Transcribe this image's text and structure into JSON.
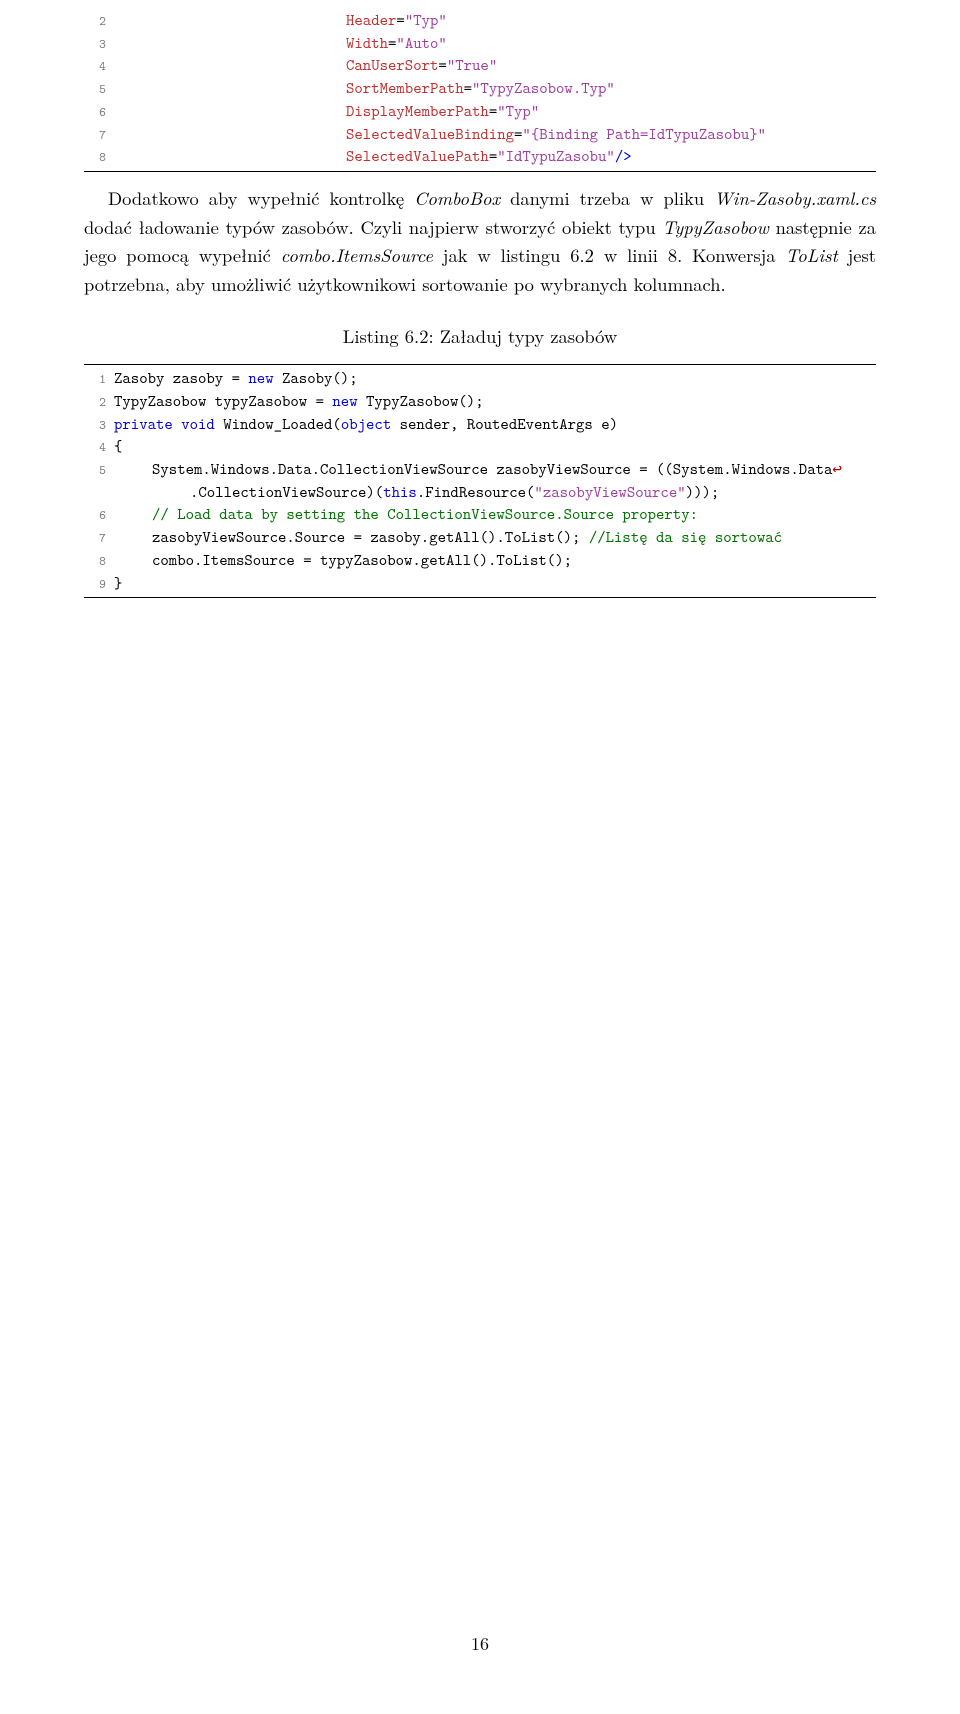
{
  "block1": {
    "lines": [
      {
        "n": "2",
        "indent": "large",
        "tokens": [
          {
            "c": "attr",
            "t": "Header"
          },
          {
            "c": "op",
            "t": "="
          },
          {
            "c": "str",
            "t": "\"Typ\""
          }
        ]
      },
      {
        "n": "3",
        "indent": "large",
        "tokens": [
          {
            "c": "attr",
            "t": "Width"
          },
          {
            "c": "op",
            "t": "="
          },
          {
            "c": "str",
            "t": "\"Auto\""
          }
        ]
      },
      {
        "n": "4",
        "indent": "large",
        "tokens": [
          {
            "c": "attr",
            "t": "CanUserSort"
          },
          {
            "c": "op",
            "t": "="
          },
          {
            "c": "str",
            "t": "\"True\""
          }
        ]
      },
      {
        "n": "5",
        "indent": "large",
        "tokens": [
          {
            "c": "attr",
            "t": "SortMemberPath"
          },
          {
            "c": "op",
            "t": "="
          },
          {
            "c": "str",
            "t": "\"TypyZasobow.Typ\""
          }
        ]
      },
      {
        "n": "6",
        "indent": "large",
        "tokens": [
          {
            "c": "attr",
            "t": "DisplayMemberPath"
          },
          {
            "c": "op",
            "t": "="
          },
          {
            "c": "str",
            "t": "\"Typ\""
          }
        ]
      },
      {
        "n": "7",
        "indent": "large",
        "tokens": [
          {
            "c": "attr",
            "t": "SelectedValueBinding"
          },
          {
            "c": "op",
            "t": "="
          },
          {
            "c": "str",
            "t": "\"{Binding Path=IdTypuZasobu}\""
          }
        ]
      },
      {
        "n": "8",
        "indent": "large",
        "tokens": [
          {
            "c": "attr",
            "t": "SelectedValuePath"
          },
          {
            "c": "op",
            "t": "="
          },
          {
            "c": "str",
            "t": "\"IdTypuZasobu\""
          },
          {
            "c": "kw",
            "t": "/>"
          }
        ]
      }
    ]
  },
  "para1": {
    "pre": "Dodatkowo aby wypełnić kontrolkę ",
    "it1": "ComboBox",
    "mid1": " danymi trzeba w pliku ",
    "it2": "Win-Zasoby.xaml.cs",
    "mid2": " dodać ładowanie typów zasobów. Czyli najpierw stworzyć obiekt typu ",
    "it3": "TypyZasobow",
    "mid3": " następnie za jego pomocą wypełnić ",
    "it4": "combo.ItemsSource",
    "mid4": " jak w listingu 6.2 w linii 8. Konwersja ",
    "it5": "ToList",
    "mid5": " jest potrzebna, aby umożliwić użytkownikowi sortowanie po wybranych kolumnach."
  },
  "caption": "Listing 6.2: Załaduj typy zasobów",
  "block2": {
    "lines": [
      {
        "n": "1",
        "indent": "",
        "tokens": [
          {
            "c": "id",
            "t": "Zasoby zasoby = "
          },
          {
            "c": "kw",
            "t": "new"
          },
          {
            "c": "id",
            "t": " Zasoby();"
          }
        ]
      },
      {
        "n": "2",
        "indent": "",
        "tokens": [
          {
            "c": "id",
            "t": "TypyZasobow typyZasobow = "
          },
          {
            "c": "kw",
            "t": "new"
          },
          {
            "c": "id",
            "t": " TypyZasobow();"
          }
        ]
      },
      {
        "n": "3",
        "indent": "",
        "tokens": [
          {
            "c": "kw",
            "t": "private void"
          },
          {
            "c": "id",
            "t": " Window_Loaded("
          },
          {
            "c": "kw",
            "t": "object"
          },
          {
            "c": "id",
            "t": " sender, RoutedEventArgs e)"
          }
        ]
      },
      {
        "n": "4",
        "indent": "",
        "tokens": [
          {
            "c": "id",
            "t": "{"
          }
        ]
      },
      {
        "n": "5",
        "indent": "ind1",
        "tokens": [
          {
            "c": "id",
            "t": "System.Windows.Data.CollectionViewSource zasobyViewSource = ((System.Windows.Data"
          },
          {
            "c": "wrap",
            "t": "↩"
          }
        ],
        "cont": [
          {
            "c": "id",
            "t": ".CollectionViewSource)("
          },
          {
            "c": "kw",
            "t": "this"
          },
          {
            "c": "id",
            "t": ".FindResource("
          },
          {
            "c": "str",
            "t": "\"zasobyViewSource\""
          },
          {
            "c": "id",
            "t": ")));"
          }
        ]
      },
      {
        "n": "6",
        "indent": "ind1",
        "tokens": [
          {
            "c": "comment",
            "t": "// Load data by setting the CollectionViewSource.Source property:"
          }
        ]
      },
      {
        "n": "7",
        "indent": "ind1",
        "tokens": [
          {
            "c": "id",
            "t": "zasobyViewSource.Source = zasoby.getAll().ToList(); "
          },
          {
            "c": "comment",
            "t": "//Listę da się sortować"
          }
        ]
      },
      {
        "n": "8",
        "indent": "ind1",
        "tokens": [
          {
            "c": "id",
            "t": "combo.ItemsSource = typyZasobow.getAll().ToList();"
          }
        ]
      },
      {
        "n": "9",
        "indent": "",
        "tokens": [
          {
            "c": "id",
            "t": "}"
          }
        ]
      }
    ]
  },
  "page_number": "16"
}
